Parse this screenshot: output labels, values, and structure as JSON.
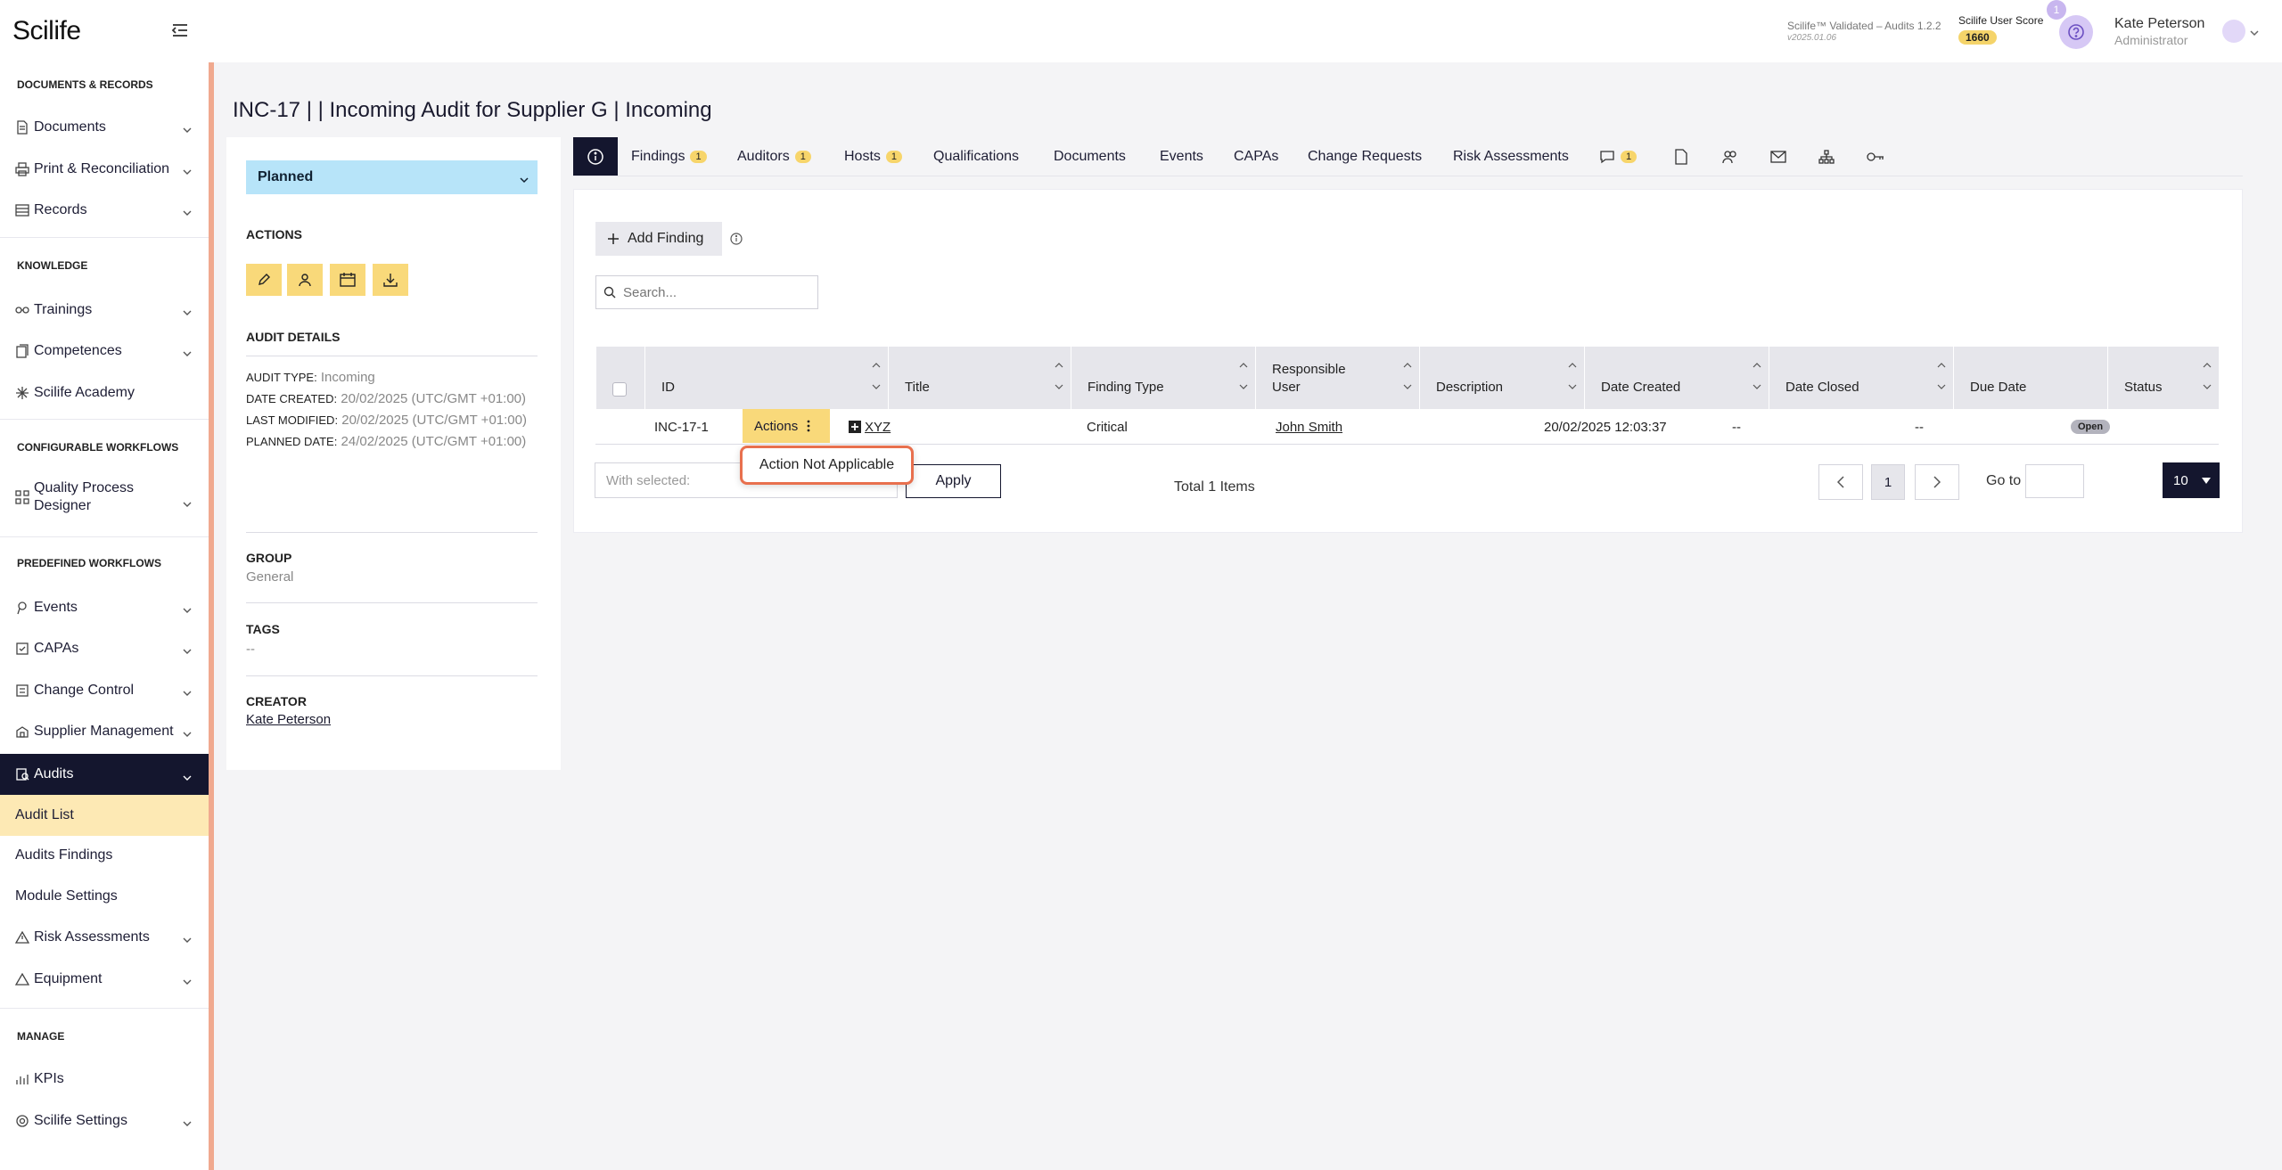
{
  "app": {
    "logo": "Scilife",
    "version_line1": "Scilife™ Validated – Audits 1.2.2",
    "version_line2": "v2025.01.06",
    "score_label": "Scilife User Score",
    "score_value": "1660",
    "notification_count": "1",
    "user_name": "Kate Peterson",
    "user_role": "Administrator"
  },
  "sidebar": {
    "sections": {
      "docs": "DOCUMENTS & RECORDS",
      "knowledge": "KNOWLEDGE",
      "configurable": "CONFIGURABLE WORKFLOWS",
      "predefined": "PREDEFINED WORKFLOWS",
      "manage": "MANAGE"
    },
    "items": [
      {
        "label": "Documents",
        "icon": "document-icon"
      },
      {
        "label": "Print & Reconciliation",
        "icon": "printer-icon"
      },
      {
        "label": "Records",
        "icon": "records-icon"
      },
      {
        "label": "Trainings",
        "icon": "training-icon"
      },
      {
        "label": "Competences",
        "icon": "competences-icon"
      },
      {
        "label": "Scilife Academy",
        "icon": "academy-icon"
      },
      {
        "label": "Quality Process Designer",
        "icon": "designer-icon"
      },
      {
        "label": "Events",
        "icon": "events-icon"
      },
      {
        "label": "CAPAs",
        "icon": "capa-icon"
      },
      {
        "label": "Change Control",
        "icon": "change-control-icon"
      },
      {
        "label": "Supplier Management",
        "icon": "supplier-icon"
      },
      {
        "label": "Audits",
        "icon": "audits-icon"
      },
      {
        "label": "Audit List"
      },
      {
        "label": "Audits Findings"
      },
      {
        "label": "Module Settings"
      },
      {
        "label": "Risk Assessments",
        "icon": "warning-icon"
      },
      {
        "label": "Equipment",
        "icon": "equipment-icon"
      },
      {
        "label": "KPIs",
        "icon": "kpi-icon"
      },
      {
        "label": "Scilife Settings",
        "icon": "settings-icon"
      }
    ]
  },
  "page": {
    "title": "INC-17 |  |  Incoming Audit for Supplier G |  Incoming"
  },
  "left_panel": {
    "status": "Planned",
    "actions_heading": "ACTIONS",
    "details_heading": "AUDIT DETAILS",
    "audit_type_label": "AUDIT TYPE:",
    "audit_type": "Incoming",
    "date_created_label": "DATE CREATED:",
    "date_created": "20/02/2025 (UTC/GMT +01:00)",
    "last_modified_label": "LAST MODIFIED:",
    "last_modified": "20/02/2025 (UTC/GMT +01:00)",
    "planned_date_label": "PLANNED DATE:",
    "planned_date": "24/02/2025 (UTC/GMT +01:00)",
    "group_heading": "GROUP",
    "group": "General",
    "tags_heading": "TAGS",
    "tags": "--",
    "creator_heading": "CREATOR",
    "creator": "Kate Peterson"
  },
  "tabs": [
    {
      "label": "Findings",
      "badge": "1"
    },
    {
      "label": "Auditors",
      "badge": "1"
    },
    {
      "label": "Hosts",
      "badge": "1"
    },
    {
      "label": "Qualifications"
    },
    {
      "label": "Documents"
    },
    {
      "label": "Events"
    },
    {
      "label": "CAPAs"
    },
    {
      "label": "Change Requests"
    },
    {
      "label": "Risk Assessments"
    }
  ],
  "comments_badge": "1",
  "findings": {
    "add_label": "Add Finding",
    "search_placeholder": "Search...",
    "columns": [
      "ID",
      "Title",
      "Finding Type",
      "Responsible User",
      "Description",
      "Date Created",
      "Date Closed",
      "Due Date",
      "Status"
    ],
    "rows": [
      {
        "id": "INC-17-1",
        "actions_label": "Actions",
        "title": "XYZ",
        "finding_type": "Critical",
        "responsible": "John Smith",
        "description": "",
        "date_created": "20/02/2025 12:03:37",
        "date_closed": "--",
        "due_date": "--",
        "status": "Open"
      }
    ],
    "dropdown_item": "Action Not Applicable",
    "with_selected_placeholder": "With selected:",
    "apply_label": "Apply",
    "total": "Total 1 Items",
    "current_page": "1",
    "goto_label": "Go to",
    "page_size": "10"
  }
}
